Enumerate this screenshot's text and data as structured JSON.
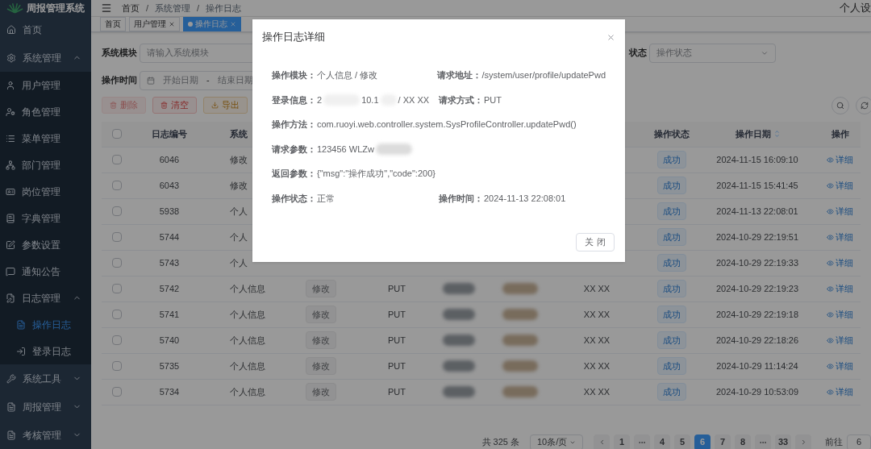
{
  "sidebar": {
    "title": "周报管理系统",
    "items": [
      {
        "label": "首页",
        "selected": false
      },
      {
        "label": "系统管理",
        "expanded": true,
        "selected": false,
        "children": [
          {
            "label": "用户管理",
            "selected": false
          },
          {
            "label": "角色管理",
            "selected": false
          },
          {
            "label": "菜单管理",
            "selected": false
          },
          {
            "label": "部门管理",
            "selected": false
          },
          {
            "label": "岗位管理",
            "selected": false
          },
          {
            "label": "字典管理",
            "selected": false
          },
          {
            "label": "参数设置",
            "selected": false
          },
          {
            "label": "通知公告",
            "selected": false
          },
          {
            "label": "日志管理",
            "expanded": true,
            "selected": false,
            "children": [
              {
                "label": "操作日志",
                "selected": true
              },
              {
                "label": "登录日志",
                "selected": false
              }
            ]
          }
        ]
      },
      {
        "label": "系统工具",
        "expanded": false,
        "selected": false
      },
      {
        "label": "周报管理",
        "expanded": false,
        "selected": false
      },
      {
        "label": "考核管理",
        "expanded": false,
        "selected": false
      }
    ]
  },
  "navbar": {
    "breadcrumb": [
      "首页",
      "系统管理",
      "操作日志"
    ],
    "separator": "/",
    "user_menu": "个人设"
  },
  "tags": [
    {
      "label": "首页",
      "closable": false,
      "selected": false
    },
    {
      "label": "用户管理",
      "closable": true,
      "selected": false
    },
    {
      "label": "操作日志",
      "closable": true,
      "selected": true
    }
  ],
  "search_form": {
    "module_label": "系统模块",
    "module_placeholder": "请输入系统模块",
    "status_label": "状态",
    "status_placeholder": "操作状态",
    "time_label": "操作时间",
    "start_placeholder": "开始日期",
    "range_separator": "-",
    "end_placeholder": "结束日期"
  },
  "toolbar": [
    {
      "label": "删除",
      "kind": "danger",
      "disabled": true
    },
    {
      "label": "清空",
      "kind": "danger",
      "disabled": false
    },
    {
      "label": "导出",
      "kind": "warning",
      "disabled": false
    }
  ],
  "table": {
    "select_all_checked": false,
    "headers": [
      {
        "label": "日志编号"
      },
      {
        "label": "系统"
      },
      {
        "label": "操作状态"
      },
      {
        "label": "操作日期",
        "sortable": true
      },
      {
        "label": "操作"
      }
    ],
    "rows": [
      {
        "checked": false,
        "id": "6046",
        "module": "修改",
        "status": "成功",
        "date": "2024-11-15 16:09:10",
        "action": "详细"
      },
      {
        "checked": false,
        "id": "6043",
        "module": "修改",
        "status": "成功",
        "date": "2024-11-15 15:41:45",
        "action": "详细"
      },
      {
        "checked": false,
        "id": "5938",
        "module": "个人",
        "status": "成功",
        "date": "2024-11-13 22:08:01",
        "action": "详细"
      },
      {
        "checked": false,
        "id": "5744",
        "module": "个人",
        "status": "成功",
        "date": "2024-10-29 22:19:51",
        "action": "详细"
      },
      {
        "checked": false,
        "id": "5743",
        "module": "个人",
        "status": "成功",
        "date": "2024-10-29 22:19:33",
        "action": "详细"
      },
      {
        "checked": false,
        "id": "5742",
        "module": "个人信息",
        "type": "修改",
        "method": "PUT",
        "location": "XX XX",
        "status": "成功",
        "date": "2024-10-29 22:19:23",
        "action": "详细"
      },
      {
        "checked": false,
        "id": "5741",
        "module": "个人信息",
        "type": "修改",
        "method": "PUT",
        "location": "XX XX",
        "status": "成功",
        "date": "2024-10-29 22:19:18",
        "action": "详细"
      },
      {
        "checked": false,
        "id": "5740",
        "module": "个人信息",
        "type": "修改",
        "method": "PUT",
        "location": "XX XX",
        "status": "成功",
        "date": "2024-10-29 22:18:26",
        "action": "详细"
      },
      {
        "checked": false,
        "id": "5735",
        "module": "个人信息",
        "type": "修改",
        "method": "PUT",
        "location": "XX XX",
        "status": "成功",
        "date": "2024-10-29 11:14:24",
        "action": "详细"
      },
      {
        "checked": false,
        "id": "5734",
        "module": "个人信息",
        "type": "修改",
        "method": "PUT",
        "location": "XX XX",
        "status": "成功",
        "date": "2024-10-29 10:53:09",
        "action": "详细"
      }
    ]
  },
  "pagination": {
    "total": "共 325 条",
    "page_size": "10条/页",
    "pages": [
      {
        "kind": "page",
        "label": "1",
        "selected": false
      },
      {
        "kind": "more"
      },
      {
        "kind": "page",
        "label": "4",
        "selected": false
      },
      {
        "kind": "page",
        "label": "5",
        "selected": false
      },
      {
        "kind": "page",
        "label": "6",
        "selected": true
      },
      {
        "kind": "page",
        "label": "7",
        "selected": false
      },
      {
        "kind": "page",
        "label": "8",
        "selected": false
      },
      {
        "kind": "more"
      },
      {
        "kind": "page",
        "label": "33",
        "selected": false
      }
    ],
    "jump_label": "前往",
    "jump_value": "6"
  },
  "dialog": {
    "title": "操作日志详细",
    "rows": [
      [
        {
          "label": "操作模块：",
          "parts": [
            "个人信息 / 修改"
          ]
        },
        {
          "label": "请求地址：",
          "parts": [
            "/system/user/profile/updatePwd"
          ]
        }
      ],
      [
        {
          "label": "登录信息：",
          "parts": [
            "2",
            "10.1",
            "/ XX XX"
          ]
        },
        {
          "label": "请求方式：",
          "parts": [
            "PUT"
          ]
        }
      ],
      [
        {
          "label": "操作方法：",
          "parts": [
            "com.ruoyi.web.controller.system.SysProfileController.updatePwd()"
          ]
        }
      ],
      [
        {
          "label": "请求参数：",
          "parts": [
            "123456 WLZw"
          ],
          "redacted_tail": true
        }
      ],
      [
        {
          "label": "返回参数：",
          "parts": [
            "{\"msg\":\"操作成功\",\"code\":200}"
          ]
        }
      ],
      [
        {
          "label": "操作状态：",
          "parts": [
            "正常"
          ]
        },
        {
          "label": "操作时间：",
          "parts": [
            "2024-11-13 22:08:01"
          ]
        }
      ]
    ],
    "close_button": "关 闭"
  }
}
